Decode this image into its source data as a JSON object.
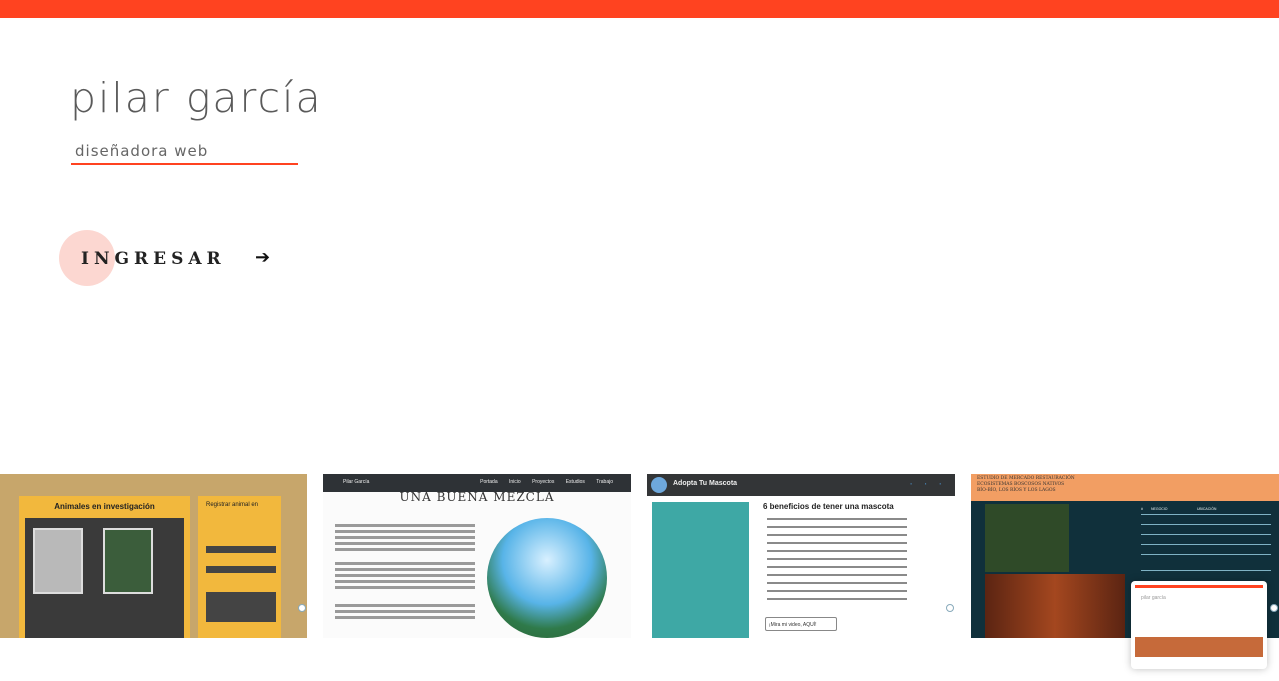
{
  "colors": {
    "accent": "#ff4320",
    "cta_circle": "#fcd7d1"
  },
  "header": {
    "name": "pilar garcía",
    "role": "diseñadora web"
  },
  "cta": {
    "label": "INGRESAR",
    "arrow_icon": "arrow-right-icon"
  },
  "projects": [
    {
      "title": "Animales en investigación",
      "form_title": "Registrar animal en",
      "icon": "eye-icon"
    },
    {
      "brand": "Pilar García",
      "nav": [
        "Portada",
        "Inicio",
        "Proyectos",
        "Estudios",
        "Trabajo"
      ],
      "heading": "UNA BUENA MEZCLA"
    },
    {
      "brand": "Adopta Tu Mascota",
      "heading": "6 beneficios de tener una mascota",
      "button": "¡Mira mi video, AQUÍ!"
    },
    {
      "banner": "ESTUDIO DE MERCADO RESTAURACIÓN\nECOSISTEMAS BOSCOSOS NATIVOS\nBÍO-BÍO, LOS RÍOS Y LOS LAGOS",
      "table_headers": [
        "#",
        "NEGOCIO",
        "UBICACIÓN"
      ]
    }
  ]
}
